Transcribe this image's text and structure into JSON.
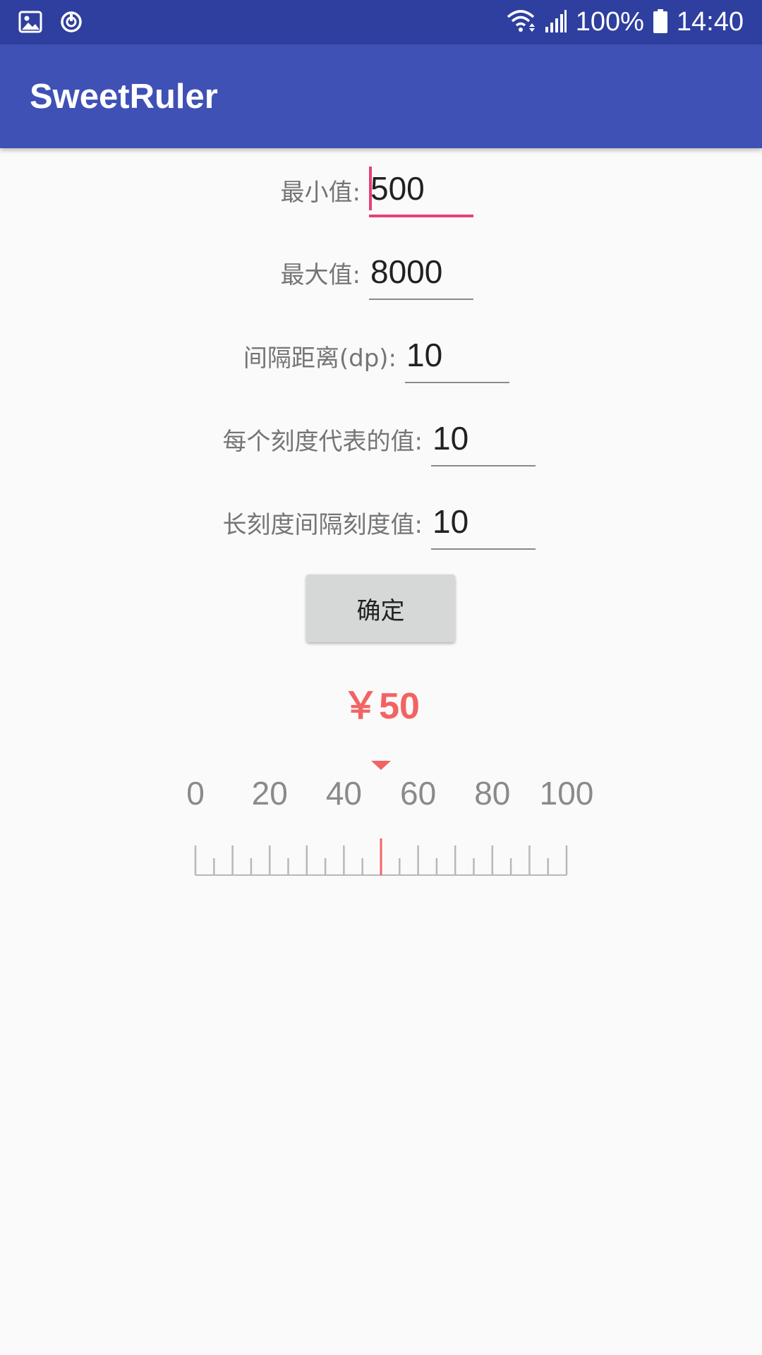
{
  "status_bar": {
    "left_icons": [
      "image-icon",
      "sync-icon"
    ],
    "right_icons": [
      "wifi-icon",
      "signal-icon",
      "battery-icon"
    ],
    "battery": "100%",
    "time": "14:40"
  },
  "app_bar": {
    "title": "SweetRuler"
  },
  "form": {
    "fields": [
      {
        "label": "最小值:",
        "value": "500"
      },
      {
        "label": "最大值:",
        "value": "8000"
      },
      {
        "label": "间隔距离(dp):",
        "value": "10"
      },
      {
        "label": "每个刻度代表的值:",
        "value": "10"
      },
      {
        "label": "长刻度间隔刻度值:",
        "value": "10"
      }
    ],
    "confirm_label": "确定"
  },
  "ruler": {
    "value_text": "￥50",
    "min": 0,
    "max": 100,
    "minor_step": 5,
    "major_step": 20,
    "current": 50,
    "tick_labels": [
      "0",
      "20",
      "40",
      "60",
      "80",
      "100"
    ],
    "colors": {
      "indicator": "#f26363",
      "tick": "#b8b8b8",
      "label": "#8a8a8a"
    }
  },
  "colors": {
    "status_bar": "#2f3f9f",
    "app_bar": "#3f51b5",
    "accent": "#e6407a"
  }
}
